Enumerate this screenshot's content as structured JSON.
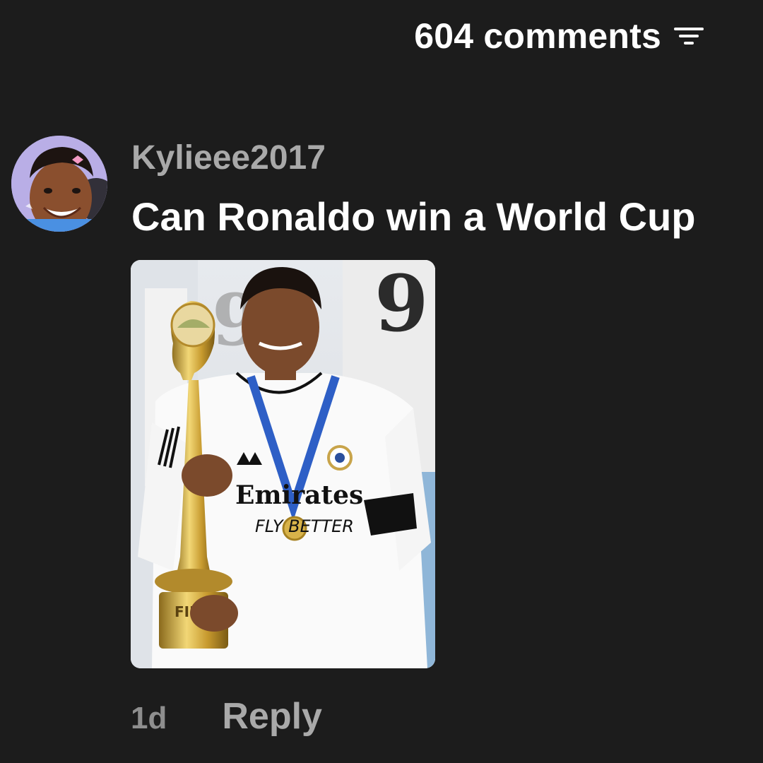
{
  "header": {
    "comments_count_label": "604 comments",
    "sort_icon": "filter-sort-icon"
  },
  "comment": {
    "username": "Kylieee2017",
    "text": "Can Ronaldo win a World Cup",
    "avatar_icon": "user-avatar",
    "photo": {
      "description_icon": "attached-photo",
      "shirt_number": "9",
      "sponsor_line1": "Emirates",
      "sponsor_line2": "FLY BETTER",
      "trophy_text": "FIFA"
    },
    "time": "1d",
    "reply_label": "Reply"
  },
  "colors": {
    "background": "#1c1c1c",
    "username": "#a9a9a9",
    "text": "#ffffff",
    "meta": "#8e8e8e"
  }
}
